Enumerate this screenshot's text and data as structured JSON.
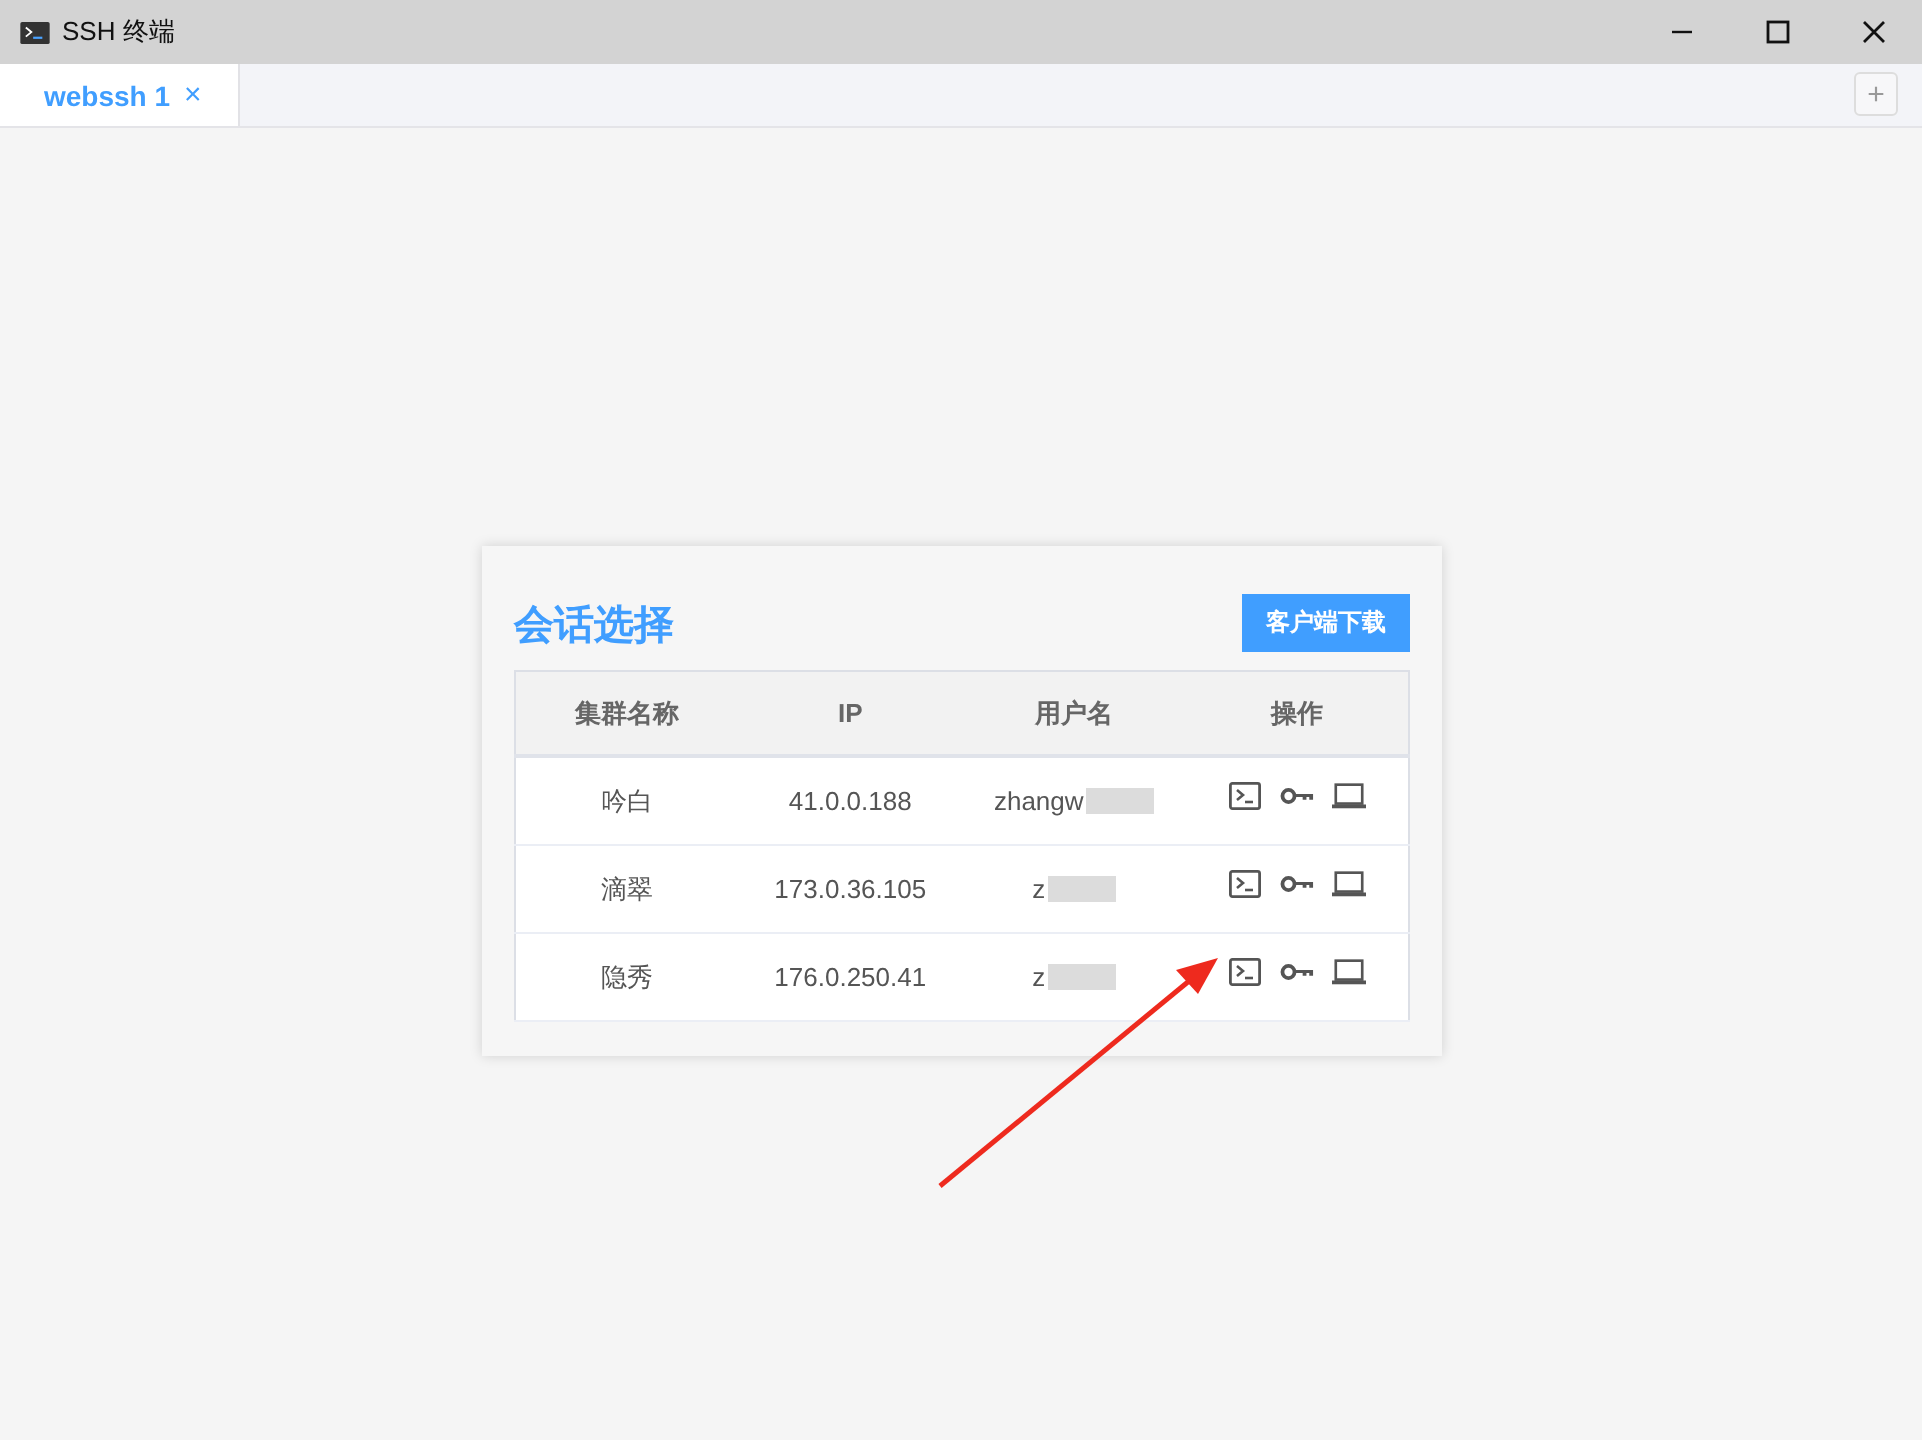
{
  "window": {
    "title": "SSH 终端"
  },
  "tabs": [
    {
      "label": "webssh 1",
      "selected": true,
      "close": "×"
    }
  ],
  "add_tab": "+",
  "panel": {
    "title": "会话选择",
    "download_button": "客户端下载",
    "columns": [
      "集群名称",
      "IP",
      "用户名",
      "操作"
    ],
    "rows": [
      {
        "cluster": "吟白",
        "ip": "41.0.0.188",
        "user": "zhangw"
      },
      {
        "cluster": "滴翠",
        "ip": "173.0.36.105",
        "user": "z"
      },
      {
        "cluster": "隐秀",
        "ip": "176.0.250.41",
        "user": "z"
      }
    ]
  }
}
